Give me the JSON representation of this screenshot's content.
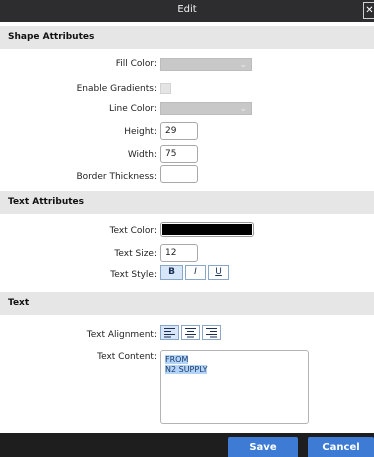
{
  "window": {
    "title": "Edit",
    "close_glyph": "✕"
  },
  "shape_attributes": {
    "header": "Shape Attributes",
    "fill_color_label": "Fill Color:",
    "enable_gradients_label": "Enable Gradients:",
    "line_color_label": "Line Color:",
    "height_label": "Height:",
    "height_value": "29",
    "width_label": "Width:",
    "width_value": "75",
    "border_thickness_label": "Border Thickness:",
    "border_thickness_value": ""
  },
  "text_attributes": {
    "header": "Text Attributes",
    "text_color_label": "Text Color:",
    "text_color": "#000000",
    "text_size_label": "Text Size:",
    "text_size_value": "12",
    "text_style_label": "Text Style:",
    "style_bold": "B",
    "style_italic": "I",
    "style_underline": "U"
  },
  "text_section": {
    "header": "Text",
    "text_alignment_label": "Text Alignment:",
    "alignment_icons": [
      "align-left-icon",
      "align-center-icon",
      "align-right-icon"
    ],
    "text_content_label": "Text Content:",
    "content_line_1": "FROM",
    "content_line_2": "N2 SUPPLY"
  },
  "footer": {
    "save_label": "Save",
    "cancel_label": "Cancel"
  },
  "colors": {
    "accent": "#3d7bd4",
    "titlebar": "#2d2d30",
    "section_header": "#e6e6e6"
  }
}
